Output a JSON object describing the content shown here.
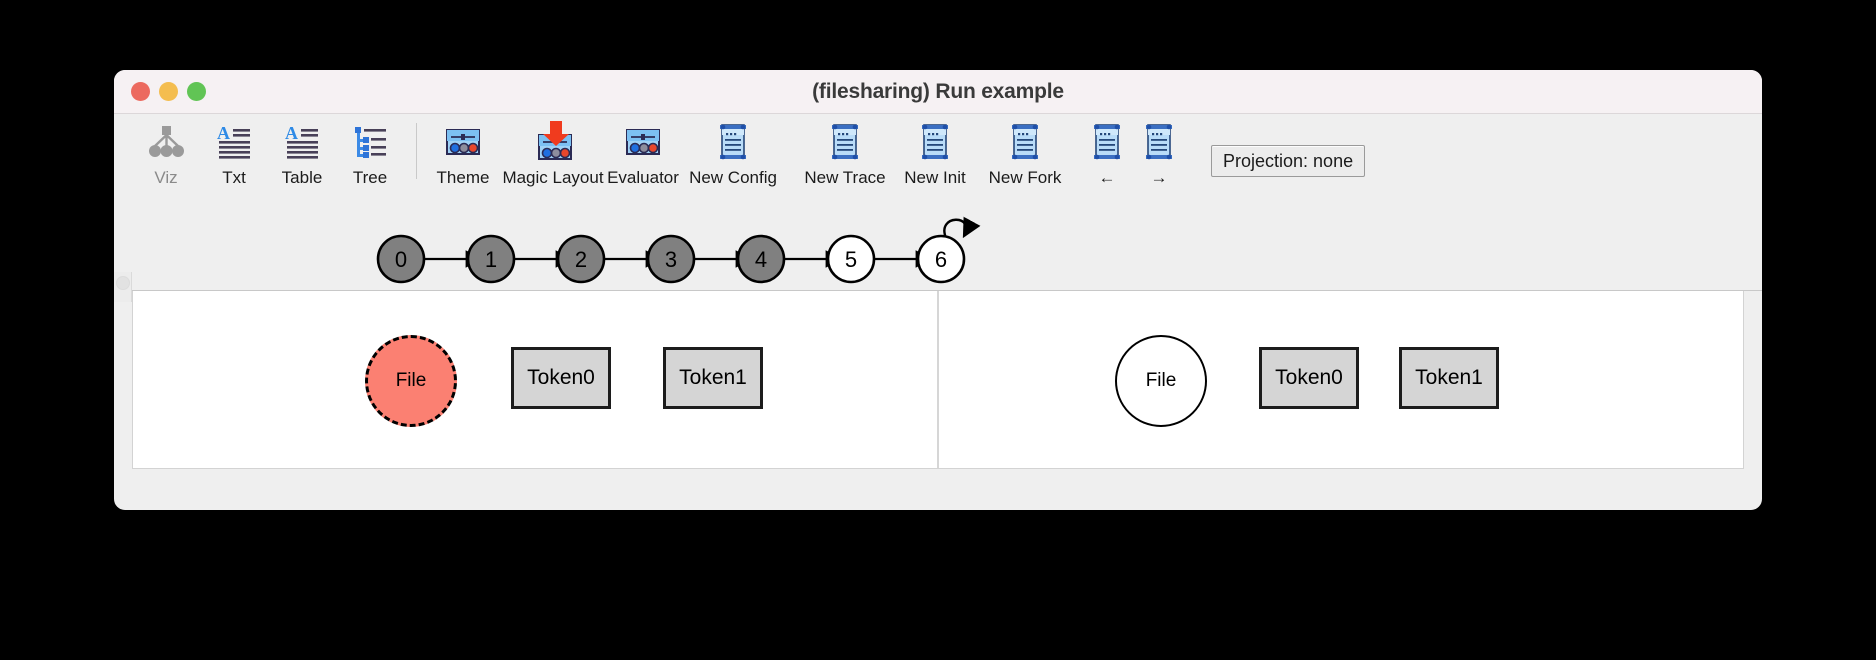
{
  "window": {
    "title": "(filesharing) Run example",
    "traffic_lights": [
      {
        "name": "close",
        "color": "#ec6a5f"
      },
      {
        "name": "minimize",
        "color": "#f4bd4f"
      },
      {
        "name": "zoom",
        "color": "#61c455"
      }
    ]
  },
  "toolbar": {
    "items": [
      {
        "label": "Viz",
        "icon": "hierarchy-tree-icon",
        "dim": true,
        "group": 1,
        "width": "normal"
      },
      {
        "label": "Txt",
        "icon": "text-document-icon",
        "dim": false,
        "group": 1,
        "width": "normal"
      },
      {
        "label": "Table",
        "icon": "table-icon",
        "dim": false,
        "group": 1,
        "width": "normal"
      },
      {
        "label": "Tree",
        "icon": "tree-list-icon",
        "dim": false,
        "group": 1,
        "width": "normal"
      },
      {
        "label": "Theme",
        "icon": "theme-panel-icon",
        "dim": false,
        "group": 2,
        "width": "normal"
      },
      {
        "label": "Magic Layout",
        "icon": "magic-layout-icon",
        "dim": false,
        "group": 2,
        "width": "wide"
      },
      {
        "label": "Evaluator",
        "icon": "evaluator-icon",
        "dim": false,
        "group": 2,
        "width": "normal"
      },
      {
        "label": "New Config",
        "icon": "scroll-icon",
        "dim": false,
        "group": 2,
        "width": "wide"
      },
      {
        "label": "New Trace",
        "icon": "scroll-icon",
        "dim": false,
        "group": 2,
        "width": "wide"
      },
      {
        "label": "New Init",
        "icon": "scroll-icon",
        "dim": false,
        "group": 2,
        "width": "normal"
      },
      {
        "label": "New Fork",
        "icon": "scroll-icon",
        "dim": false,
        "group": 2,
        "width": "wide"
      },
      {
        "label": "←",
        "icon": "scroll-icon",
        "dim": false,
        "group": 2,
        "width": "narrow"
      },
      {
        "label": "→",
        "icon": "scroll-icon",
        "dim": false,
        "group": 2,
        "width": "narrow"
      }
    ],
    "projection_badge": "Projection: none"
  },
  "trace_graph": {
    "nodes": [
      {
        "label": "0",
        "filled": true
      },
      {
        "label": "1",
        "filled": true
      },
      {
        "label": "2",
        "filled": true
      },
      {
        "label": "3",
        "filled": true
      },
      {
        "label": "4",
        "filled": true
      },
      {
        "label": "5",
        "filled": false
      },
      {
        "label": "6",
        "filled": false
      }
    ],
    "self_loop_on": "6",
    "fill_color": "#808080",
    "empty_color": "#ffffff",
    "stroke_color": "#000000"
  },
  "panes": {
    "left": {
      "name": "current-state-pane",
      "circle": {
        "label": "File",
        "style": "dashed",
        "fill": "#fb8072"
      },
      "boxes": [
        {
          "label": "Token0"
        },
        {
          "label": "Token1"
        }
      ]
    },
    "right": {
      "name": "next-state-pane",
      "circle": {
        "label": "File",
        "style": "solid",
        "fill": "#ffffff"
      },
      "boxes": [
        {
          "label": "Token0"
        },
        {
          "label": "Token1"
        }
      ]
    }
  }
}
